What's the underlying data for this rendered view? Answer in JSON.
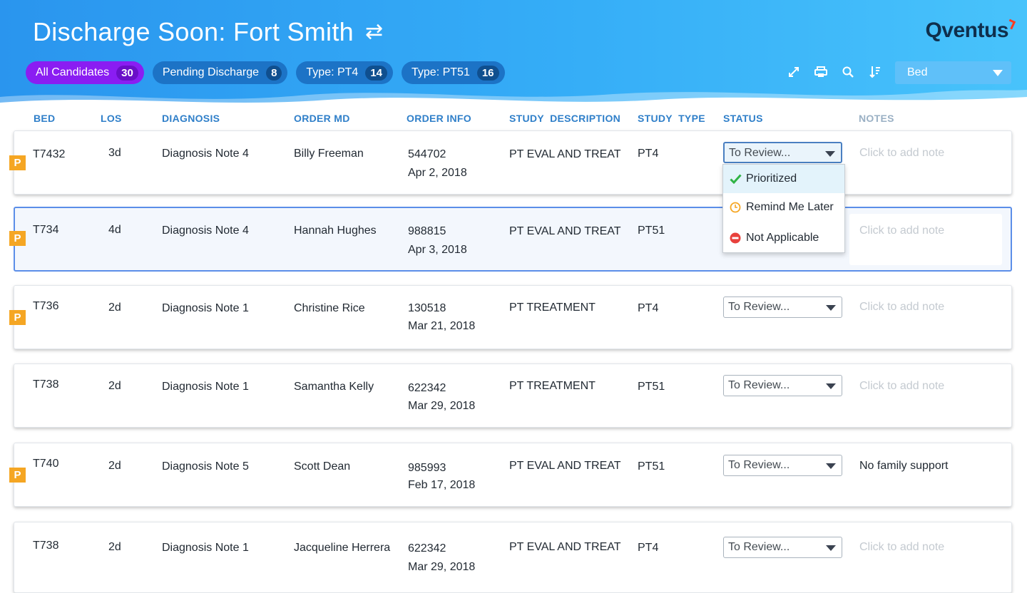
{
  "header": {
    "title": "Discharge Soon: Fort Smith",
    "logo": "Qventus",
    "filters": [
      {
        "label": "All Candidates",
        "count": "30"
      },
      {
        "label": "Pending Discharge",
        "count": "8"
      },
      {
        "label": "Type: PT4",
        "count": "14"
      },
      {
        "label": "Type: PT51",
        "count": "16"
      }
    ],
    "sort_value": "Bed"
  },
  "columns": [
    "BED",
    "LOS",
    "DIAGNOSIS",
    "ORDER MD",
    "ORDER INFO",
    "STUDY  DESCRIPTION",
    "STUDY  TYPE",
    "STATUS",
    "NOTES"
  ],
  "rows": [
    {
      "flag": "P",
      "bed": "T7432",
      "los": "3d",
      "diagnosis": "Diagnosis Note 4",
      "md": "Billy Freeman",
      "order_id": "544702",
      "order_date": "Apr 2, 2018",
      "description": "PT EVAL AND TREAT",
      "type": "PT4",
      "status": "To Review...",
      "note": "Click to add note"
    },
    {
      "flag": "P",
      "bed": "T734",
      "los": "4d",
      "diagnosis": "Diagnosis Note 4",
      "md": "Hannah Hughes",
      "order_id": "988815",
      "order_date": "Apr 3, 2018",
      "description": "PT EVAL AND TREAT",
      "type": "PT51",
      "status": "",
      "note": "Click to add note"
    },
    {
      "flag": "P",
      "bed": "T736",
      "los": "2d",
      "diagnosis": "Diagnosis Note 1",
      "md": "Christine Rice",
      "order_id": "130518",
      "order_date": "Mar 21, 2018",
      "description": "PT TREATMENT",
      "type": "PT4",
      "status": "To Review...",
      "note": "Click to add note"
    },
    {
      "flag": "",
      "bed": "T738",
      "los": "2d",
      "diagnosis": "Diagnosis Note 1",
      "md": "Samantha Kelly",
      "order_id": "622342",
      "order_date": "Mar 29, 2018",
      "description": "PT TREATMENT",
      "type": "PT51",
      "status": "To Review...",
      "note": "Click to add note"
    },
    {
      "flag": "P",
      "bed": "T740",
      "los": "2d",
      "diagnosis": "Diagnosis Note 5",
      "md": "Scott Dean",
      "order_id": "985993",
      "order_date": "Feb 17, 2018",
      "description": "PT EVAL AND TREAT",
      "type": "PT51",
      "status": "To Review...",
      "note": "No family support"
    },
    {
      "flag": "",
      "bed": "T738",
      "los": "2d",
      "diagnosis": "Diagnosis Note 1",
      "md": "Jacqueline Herrera",
      "order_id": "622342",
      "order_date": "Mar 29, 2018",
      "description": "PT EVAL AND TREAT",
      "type": "PT4",
      "status": "To Review...",
      "note": "Click to add note"
    }
  ],
  "status_menu": [
    {
      "label": "Prioritized",
      "icon": "checkmark-icon",
      "color": "#2fb344"
    },
    {
      "label": "Remind Me Later",
      "icon": "clock-icon",
      "color": "#f5a623"
    },
    {
      "label": "Not Applicable",
      "icon": "no-entry-icon",
      "color": "#e8413c"
    }
  ],
  "colors": {
    "header_blue": "#2a95ee",
    "active_chip": "#8a1df2",
    "chip": "#1c73c6",
    "flag": "#f5a623",
    "column_header": "#2f7fc9",
    "selected_row_border": "#5b8ee8"
  }
}
